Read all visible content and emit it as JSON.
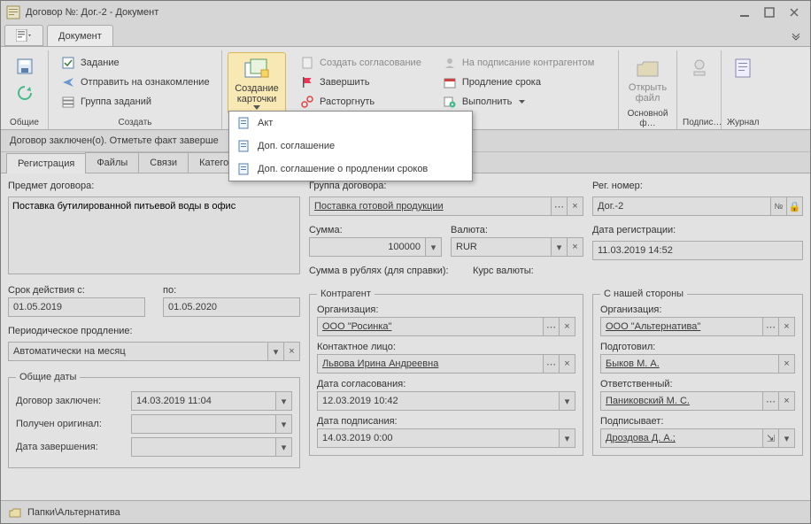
{
  "title": "Договор №: Дог.-2 - Документ",
  "menu_tab": "Документ",
  "ribbon": {
    "common_label": "Общие",
    "create_label": "Создать",
    "task": "Задание",
    "acquaint": "Отправить на ознакомление",
    "task_group": "Группа заданий",
    "create_card": "Создание карточки",
    "create_agreement": "Создать согласование",
    "finish": "Завершить",
    "terminate": "Расторгнуть",
    "sign_counterparty": "На подписание контрагентом",
    "extend": "Продление срока",
    "execute": "Выполнить",
    "open_file": "Открыть файл",
    "main_f": "Основной ф…",
    "sign_label": "Подпис…",
    "log_label": "Журнал"
  },
  "status_line": "Договор заключен(о). Отметьте факт заверше",
  "tabs": {
    "reg": "Регистрация",
    "files": "Файлы",
    "links": "Связи",
    "cats": "Категории"
  },
  "form": {
    "subject_lbl": "Предмет договора:",
    "subject_val": "Поставка бутилированной питьевой воды в офис",
    "valid_from_lbl": "Срок действия с:",
    "valid_from": "01.05.2019",
    "valid_to_lbl": "по:",
    "valid_to": "01.05.2020",
    "periodic_lbl": "Периодическое продление:",
    "periodic_val": "Автоматически на  месяц",
    "dates_legend": "Общие даты",
    "concluded_lbl": "Договор заключен:",
    "concluded_val": "14.03.2019 11:04",
    "original_lbl": "Получен оригинал:",
    "end_lbl": "Дата завершения:",
    "group_lbl": "Группа договора:",
    "group_val": "Поставка готовой продукции",
    "sum_lbl": "Сумма:",
    "sum_val": "100000",
    "currency_lbl": "Валюта:",
    "currency_val": "RUR",
    "sum_rub_lbl": "Сумма в рублях (для справки):",
    "rate_lbl": "Курс валюты:",
    "counterparty_legend": "Контрагент",
    "org_lbl": "Организация:",
    "org_val": "ООО \"Росинка\"",
    "contact_lbl": "Контактное лицо:",
    "contact_val": "Львова Ирина Андреевна",
    "agree_date_lbl": "Дата согласования:",
    "agree_date_val": "12.03.2019 10:42",
    "sign_date_lbl": "Дата подписания:",
    "sign_date_val": "14.03.2019 0:00",
    "reg_num_lbl": "Рег. номер:",
    "reg_num_val": "Дог.-2",
    "reg_date_lbl": "Дата регистрации:",
    "reg_date_val": "11.03.2019 14:52",
    "our_side_legend": "С нашей стороны",
    "our_org_lbl": "Организация:",
    "our_org_val": "ООО \"Альтернатива\"",
    "prepared_lbl": "Подготовил:",
    "prepared_val": "Быков М. А.",
    "responsible_lbl": "Ответственный:",
    "responsible_val": "Паниковский М. С.",
    "signer_lbl": "Подписывает:",
    "signer_val": "Дроздова Д. А.;"
  },
  "popup": {
    "item1": "Акт",
    "item2": "Доп. соглашение",
    "item3": "Доп. соглашение о продлении сроков"
  },
  "footer": "Папки\\Альтернатива"
}
